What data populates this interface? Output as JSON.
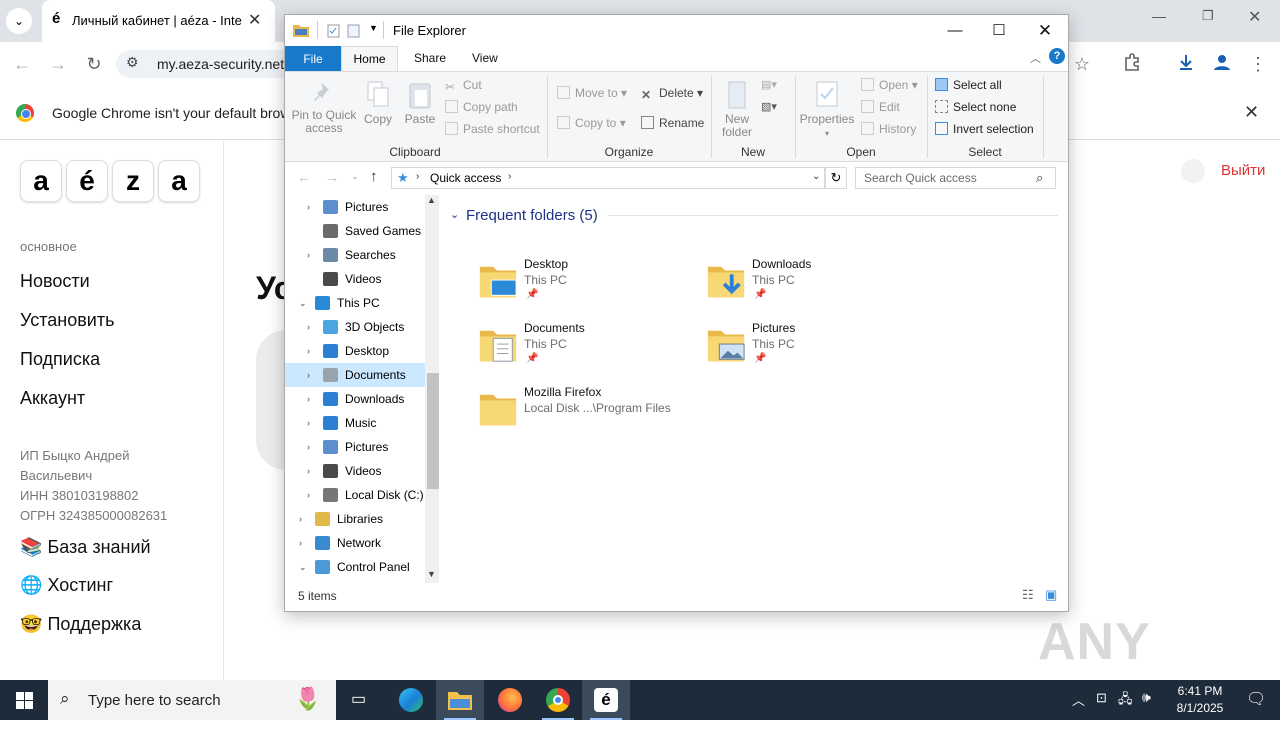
{
  "browser": {
    "tab_title": "Личный кабинет | aéza - Intern",
    "tab_favicon": "é",
    "url": "my.aeza-security.net",
    "infobar_text": "Google Chrome isn't your default browse"
  },
  "site": {
    "logo_letters": [
      "a",
      "é",
      "z",
      "a"
    ],
    "section_label": "основное",
    "nav": [
      "Новости",
      "Установить",
      "Подписка",
      "Аккаунт"
    ],
    "company": [
      "ИП Быцко Андрей",
      "Васильевич",
      "ИНН 380103198802",
      "ОГРН 324385000082631"
    ],
    "extra_links": [
      {
        "emoji": "📚",
        "label": "База знаний"
      },
      {
        "emoji": "🌐",
        "label": "Хостинг"
      },
      {
        "emoji": "🤓",
        "label": "Поддержка"
      }
    ],
    "logout": "Выйти",
    "heading_fragment": "Ус"
  },
  "explorer": {
    "title": "File Explorer",
    "ribbon_tabs": {
      "file": "File",
      "home": "Home",
      "share": "Share",
      "view": "View"
    },
    "clipboard": {
      "pin_line1": "Pin to Quick",
      "pin_line2": "access",
      "copy": "Copy",
      "paste": "Paste",
      "cut": "Cut",
      "copy_path": "Copy path",
      "paste_shortcut": "Paste shortcut",
      "group": "Clipboard"
    },
    "organize": {
      "move_to": "Move to",
      "copy_to": "Copy to",
      "delete": "Delete",
      "rename": "Rename",
      "group": "Organize"
    },
    "new_group": {
      "new_folder_line1": "New",
      "new_folder_line2": "folder",
      "group": "New"
    },
    "open_group": {
      "properties": "Properties",
      "open": "Open",
      "edit": "Edit",
      "history": "History",
      "group": "Open"
    },
    "select_group": {
      "select_all": "Select all",
      "select_none": "Select none",
      "invert": "Invert selection",
      "group": "Select"
    },
    "address": "Quick access",
    "search_placeholder": "Search Quick access",
    "tree": [
      {
        "label": "Pictures",
        "icon": "pictures-icon",
        "level": 1,
        "arrow": "›"
      },
      {
        "label": "Saved Games",
        "icon": "saved-games-icon",
        "level": 1,
        "arrow": ""
      },
      {
        "label": "Searches",
        "icon": "searches-icon",
        "level": 1,
        "arrow": "›"
      },
      {
        "label": "Videos",
        "icon": "videos-icon",
        "level": 1,
        "arrow": ""
      },
      {
        "label": "This PC",
        "icon": "this-pc-icon",
        "level": 0,
        "arrow": "⌄"
      },
      {
        "label": "3D Objects",
        "icon": "3d-objects-icon",
        "level": 1,
        "arrow": "›"
      },
      {
        "label": "Desktop",
        "icon": "desktop-icon",
        "level": 1,
        "arrow": "›"
      },
      {
        "label": "Documents",
        "icon": "documents-icon",
        "level": 1,
        "arrow": "›",
        "selected": true
      },
      {
        "label": "Downloads",
        "icon": "downloads-icon",
        "level": 1,
        "arrow": "›"
      },
      {
        "label": "Music",
        "icon": "music-icon",
        "level": 1,
        "arrow": "›"
      },
      {
        "label": "Pictures",
        "icon": "pictures-icon",
        "level": 1,
        "arrow": "›"
      },
      {
        "label": "Videos",
        "icon": "videos-icon",
        "level": 1,
        "arrow": "›"
      },
      {
        "label": "Local Disk (C:)",
        "icon": "local-disk-icon",
        "level": 1,
        "arrow": "›"
      },
      {
        "label": "Libraries",
        "icon": "libraries-icon",
        "level": 0,
        "arrow": "›"
      },
      {
        "label": "Network",
        "icon": "network-icon",
        "level": 0,
        "arrow": "›"
      },
      {
        "label": "Control Panel",
        "icon": "control-panel-icon",
        "level": 0,
        "arrow": "⌄"
      }
    ],
    "group_header": "Frequent folders (5)",
    "folders": [
      {
        "name": "Desktop",
        "location": "This PC",
        "pinned": true,
        "overlay": "desktop"
      },
      {
        "name": "Downloads",
        "location": "This PC",
        "pinned": true,
        "overlay": "downloads"
      },
      {
        "name": "Documents",
        "location": "This PC",
        "pinned": true,
        "overlay": "documents"
      },
      {
        "name": "Pictures",
        "location": "This PC",
        "pinned": true,
        "overlay": "pictures"
      },
      {
        "name": "Mozilla Firefox",
        "location": "Local Disk ...\\Program Files",
        "pinned": false,
        "overlay": "none"
      }
    ],
    "status": "5 items"
  },
  "taskbar": {
    "search_placeholder": "Type here to search",
    "time": "6:41 PM",
    "date": "8/1/2025"
  },
  "watermark": "ANY RUN",
  "colors": {
    "accent": "#1979ca",
    "selection": "#cce8ff",
    "logout": "#dd3333",
    "taskbar": "#1d2b3a"
  }
}
